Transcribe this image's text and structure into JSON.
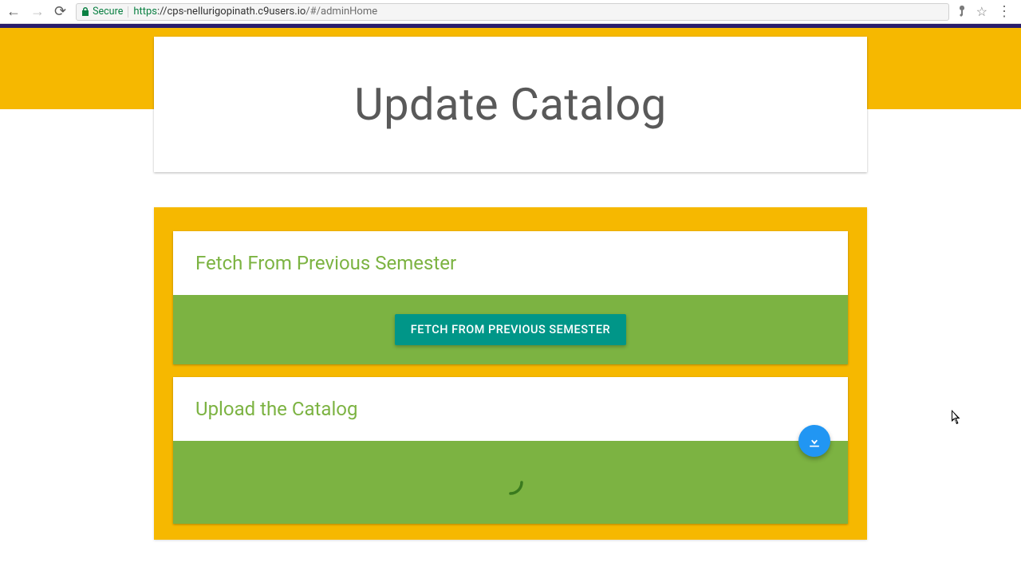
{
  "browser": {
    "secure_label": "Secure",
    "url_proto": "https",
    "url_host": "://cps-nellurigopinath.c9users.io",
    "url_path": "/#/adminHome"
  },
  "page": {
    "title": "Update Catalog"
  },
  "sections": {
    "fetch": {
      "title": "Fetch From Previous Semester",
      "button": "FETCH FROM PREVIOUS SEMESTER"
    },
    "upload": {
      "title": "Upload the Catalog"
    }
  },
  "colors": {
    "accent_yellow": "#f6b800",
    "green": "#7cb342",
    "teal": "#009688",
    "fab_blue": "#2196f3",
    "indigo": "#2a1d6b"
  }
}
